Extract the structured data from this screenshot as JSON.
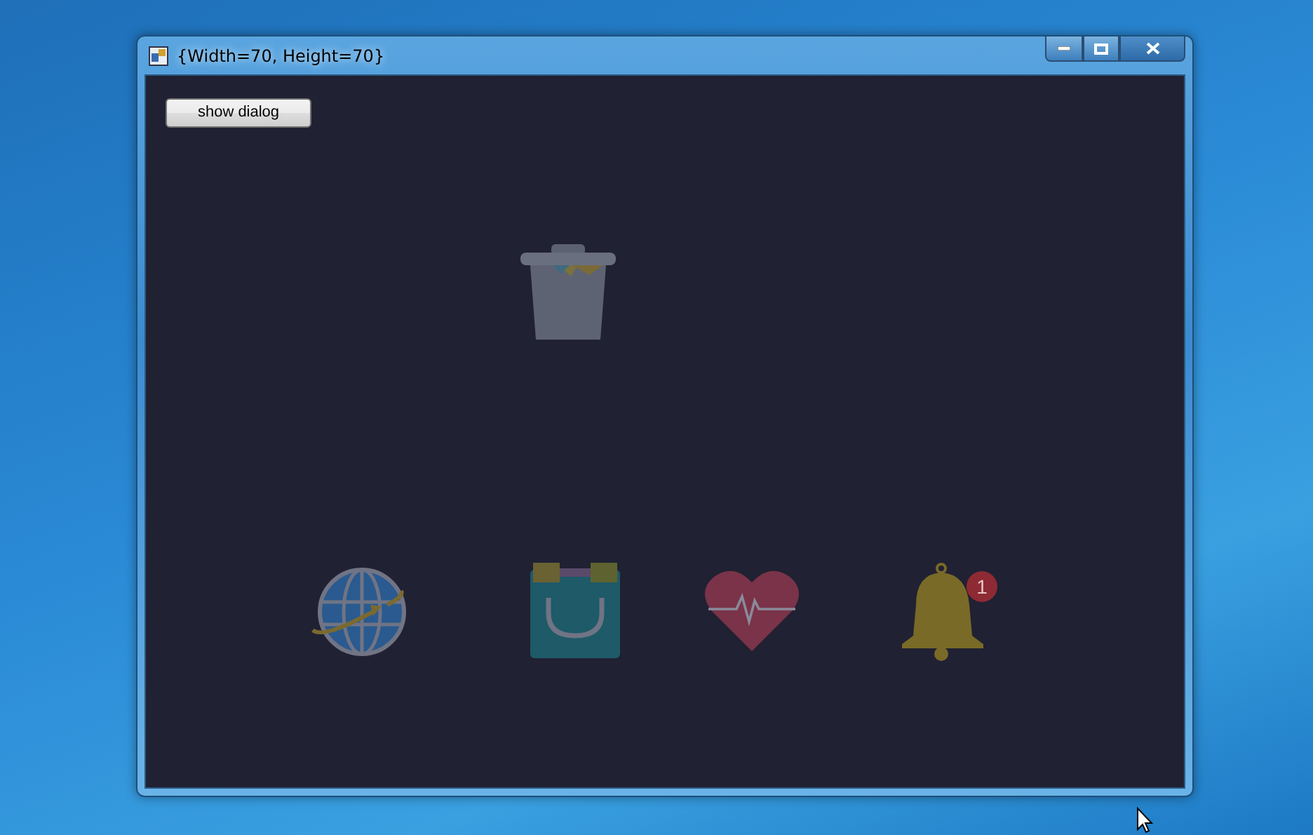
{
  "window": {
    "title": "{Width=70, Height=70}"
  },
  "button": {
    "label": "show dialog"
  },
  "canvas": {
    "items": [
      {
        "kind": "trash"
      },
      {
        "kind": "globe"
      },
      {
        "kind": "bag"
      },
      {
        "kind": "heart"
      },
      {
        "kind": "bell",
        "badge": "1"
      }
    ]
  }
}
